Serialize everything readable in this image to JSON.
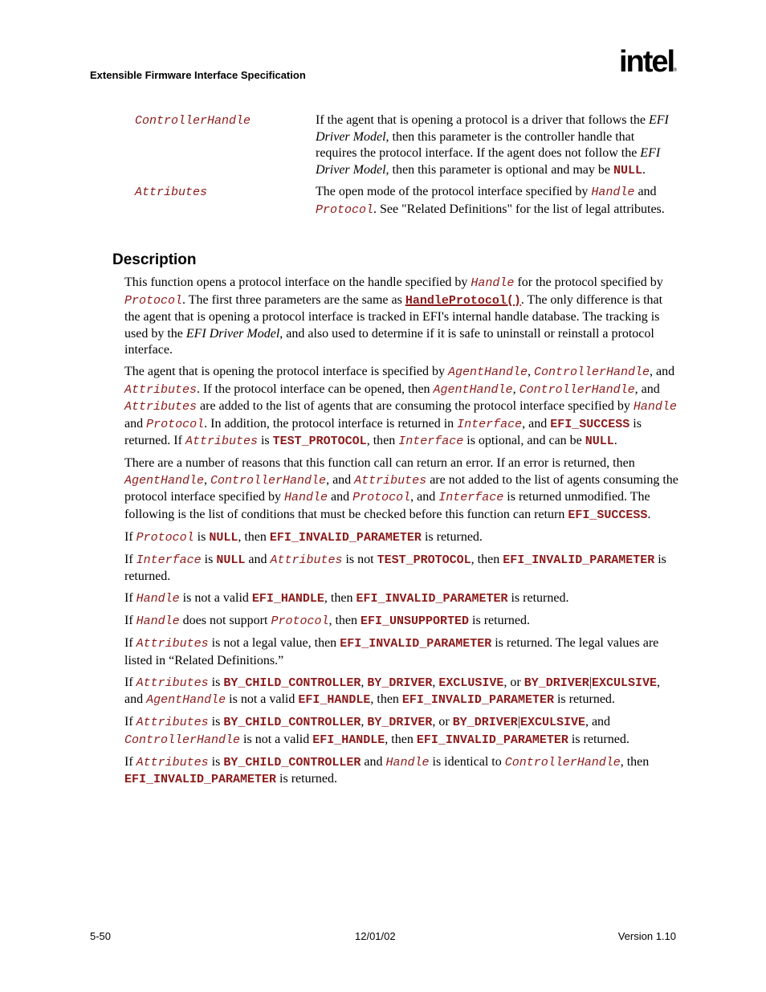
{
  "header": {
    "title": "Extensible Firmware Interface Specification",
    "logo_text": "intel",
    "logo_mark": "®"
  },
  "parameters": [
    {
      "name": "ControllerHandle",
      "desc": [
        {
          "t": "text",
          "v": "If the agent that is opening a protocol is a driver that follows the "
        },
        {
          "t": "em",
          "v": "EFI Driver Model"
        },
        {
          "t": "text",
          "v": ", then this parameter is the controller handle that requires the protocol interface.  If the agent does not follow the "
        },
        {
          "t": "em",
          "v": "EFI Driver Model"
        },
        {
          "t": "text",
          "v": ", then this parameter is optional and may be "
        },
        {
          "t": "kw",
          "v": "NULL"
        },
        {
          "t": "text",
          "v": "."
        }
      ]
    },
    {
      "name": "Attributes",
      "desc": [
        {
          "t": "text",
          "v": "The open mode of the protocol interface specified by "
        },
        {
          "t": "arg",
          "v": "Handle"
        },
        {
          "t": "text",
          "v": " and "
        },
        {
          "t": "arg",
          "v": "Protocol"
        },
        {
          "t": "text",
          "v": ".  See \"Related Definitions\" for the list of legal attributes."
        }
      ]
    }
  ],
  "section_heading": "Description",
  "paragraphs": [
    [
      {
        "t": "text",
        "v": "This function opens a protocol interface on the handle specified by "
      },
      {
        "t": "arg",
        "v": "Handle"
      },
      {
        "t": "text",
        "v": " for the protocol specified by "
      },
      {
        "t": "arg",
        "v": "Protocol"
      },
      {
        "t": "text",
        "v": ".  The first three parameters are the same as "
      },
      {
        "t": "link",
        "v": "HandleProtocol()"
      },
      {
        "t": "text",
        "v": ".  The only difference is that the agent that is opening a protocol interface is tracked in EFI's internal handle database.  The tracking is used by the "
      },
      {
        "t": "em",
        "v": "EFI Driver Model"
      },
      {
        "t": "text",
        "v": ", and also used to determine if it is safe to uninstall or reinstall a protocol interface."
      }
    ],
    [
      {
        "t": "text",
        "v": "The agent that is opening the protocol interface is specified by "
      },
      {
        "t": "arg",
        "v": "AgentHandle"
      },
      {
        "t": "text",
        "v": ", "
      },
      {
        "t": "arg",
        "v": "ControllerHandle"
      },
      {
        "t": "text",
        "v": ", and "
      },
      {
        "t": "arg",
        "v": "Attributes"
      },
      {
        "t": "text",
        "v": ".  If the protocol interface can be opened, then "
      },
      {
        "t": "arg",
        "v": "AgentHandle"
      },
      {
        "t": "text",
        "v": ", "
      },
      {
        "t": "arg",
        "v": "ControllerHandle"
      },
      {
        "t": "text",
        "v": ", and "
      },
      {
        "t": "arg",
        "v": "Attributes"
      },
      {
        "t": "text",
        "v": " are added to the list of agents that are consuming the protocol interface specified by "
      },
      {
        "t": "arg",
        "v": "Handle"
      },
      {
        "t": "text",
        "v": " and "
      },
      {
        "t": "arg",
        "v": "Protocol"
      },
      {
        "t": "text",
        "v": ".  In addition, the protocol interface is returned in "
      },
      {
        "t": "arg",
        "v": "Interface"
      },
      {
        "t": "text",
        "v": ", and "
      },
      {
        "t": "kw",
        "v": "EFI_SUCCESS"
      },
      {
        "t": "text",
        "v": " is returned.  If "
      },
      {
        "t": "arg",
        "v": "Attributes"
      },
      {
        "t": "text",
        "v": " is "
      },
      {
        "t": "kw",
        "v": "TEST_PROTOCOL"
      },
      {
        "t": "text",
        "v": ", then "
      },
      {
        "t": "arg",
        "v": "Interface"
      },
      {
        "t": "text",
        "v": " is optional, and can be "
      },
      {
        "t": "kw",
        "v": "NULL"
      },
      {
        "t": "text",
        "v": "."
      }
    ],
    [
      {
        "t": "text",
        "v": "There are a number of reasons that this function call can return an error.  If an error is returned, then "
      },
      {
        "t": "arg",
        "v": "AgentHandle"
      },
      {
        "t": "text",
        "v": ", "
      },
      {
        "t": "arg",
        "v": "ControllerHandle"
      },
      {
        "t": "text",
        "v": ", and "
      },
      {
        "t": "arg",
        "v": "Attributes"
      },
      {
        "t": "text",
        "v": " are not added to the list of agents consuming the protocol interface specified by "
      },
      {
        "t": "arg",
        "v": "Handle"
      },
      {
        "t": "text",
        "v": " and "
      },
      {
        "t": "arg",
        "v": "Protocol"
      },
      {
        "t": "text",
        "v": ", and "
      },
      {
        "t": "arg",
        "v": "Interface"
      },
      {
        "t": "text",
        "v": " is returned unmodified.  The following is the list of conditions that must be checked before this function can return "
      },
      {
        "t": "kw",
        "v": "EFI_SUCCESS"
      },
      {
        "t": "text",
        "v": "."
      }
    ],
    [
      {
        "t": "text",
        "v": "If "
      },
      {
        "t": "arg",
        "v": "Protocol"
      },
      {
        "t": "text",
        "v": " is "
      },
      {
        "t": "kw",
        "v": "NULL"
      },
      {
        "t": "text",
        "v": ", then "
      },
      {
        "t": "kw",
        "v": "EFI_INVALID_PARAMETER"
      },
      {
        "t": "text",
        "v": " is returned."
      }
    ],
    [
      {
        "t": "text",
        "v": "If "
      },
      {
        "t": "arg",
        "v": "Interface"
      },
      {
        "t": "text",
        "v": " is "
      },
      {
        "t": "kw",
        "v": "NULL"
      },
      {
        "t": "text",
        "v": " and "
      },
      {
        "t": "arg",
        "v": "Attributes"
      },
      {
        "t": "text",
        "v": " is not "
      },
      {
        "t": "kw",
        "v": "TEST_PROTOCOL"
      },
      {
        "t": "text",
        "v": ", then "
      },
      {
        "t": "kw",
        "v": "EFI_INVALID_PARAMETER"
      },
      {
        "t": "text",
        "v": " is returned."
      }
    ],
    [
      {
        "t": "text",
        "v": "If "
      },
      {
        "t": "arg",
        "v": "Handle"
      },
      {
        "t": "text",
        "v": " is not a valid "
      },
      {
        "t": "kw",
        "v": "EFI_HANDLE"
      },
      {
        "t": "text",
        "v": ", then "
      },
      {
        "t": "kw",
        "v": "EFI_INVALID_PARAMETER"
      },
      {
        "t": "text",
        "v": " is returned."
      }
    ],
    [
      {
        "t": "text",
        "v": "If "
      },
      {
        "t": "arg",
        "v": "Handle"
      },
      {
        "t": "text",
        "v": " does not support "
      },
      {
        "t": "arg",
        "v": "Protocol"
      },
      {
        "t": "text",
        "v": ", then "
      },
      {
        "t": "kw",
        "v": "EFI_UNSUPPORTED"
      },
      {
        "t": "text",
        "v": " is returned."
      }
    ],
    [
      {
        "t": "text",
        "v": "If "
      },
      {
        "t": "arg",
        "v": "Attributes"
      },
      {
        "t": "text",
        "v": " is not a legal value, then "
      },
      {
        "t": "kw",
        "v": "EFI_INVALID_PARAMETER"
      },
      {
        "t": "text",
        "v": " is returned.  The legal values are listed in “Related Definitions.”"
      }
    ],
    [
      {
        "t": "text",
        "v": "If "
      },
      {
        "t": "arg",
        "v": "Attributes"
      },
      {
        "t": "text",
        "v": " is "
      },
      {
        "t": "kw",
        "v": "BY_CHILD_CONTROLLER"
      },
      {
        "t": "text",
        "v": ", "
      },
      {
        "t": "kw",
        "v": "BY_DRIVER"
      },
      {
        "t": "text",
        "v": ", "
      },
      {
        "t": "kw",
        "v": "EXCLUSIVE"
      },
      {
        "t": "text",
        "v": ", or "
      },
      {
        "t": "kw",
        "v": "BY_DRIVER"
      },
      {
        "t": "bar",
        "v": "|"
      },
      {
        "t": "kw",
        "v": "EXCULSIVE"
      },
      {
        "t": "text",
        "v": ", and "
      },
      {
        "t": "arg",
        "v": "AgentHandle"
      },
      {
        "t": "text",
        "v": " is not a valid "
      },
      {
        "t": "kw",
        "v": "EFI_HANDLE"
      },
      {
        "t": "text",
        "v": ", then "
      },
      {
        "t": "kw",
        "v": "EFI_INVALID_PARAMETER"
      },
      {
        "t": "text",
        "v": " is returned."
      }
    ],
    [
      {
        "t": "text",
        "v": "If "
      },
      {
        "t": "arg",
        "v": "Attributes"
      },
      {
        "t": "text",
        "v": " is "
      },
      {
        "t": "kw",
        "v": "BY_CHILD_CONTROLLER"
      },
      {
        "t": "text",
        "v": ", "
      },
      {
        "t": "kw",
        "v": "BY_DRIVER"
      },
      {
        "t": "text",
        "v": ", or "
      },
      {
        "t": "kw",
        "v": "BY_DRIVER"
      },
      {
        "t": "bar",
        "v": "|"
      },
      {
        "t": "kw",
        "v": "EXCULSIVE"
      },
      {
        "t": "text",
        "v": ", and "
      },
      {
        "t": "arg",
        "v": "ControllerHandle"
      },
      {
        "t": "text",
        "v": " is not a valid "
      },
      {
        "t": "kw",
        "v": "EFI_HANDLE"
      },
      {
        "t": "text",
        "v": ", then "
      },
      {
        "t": "kw",
        "v": "EFI_INVALID_PARAMETER"
      },
      {
        "t": "text",
        "v": " is returned."
      }
    ],
    [
      {
        "t": "text",
        "v": "If "
      },
      {
        "t": "arg",
        "v": "Attributes"
      },
      {
        "t": "text",
        "v": " is "
      },
      {
        "t": "kw",
        "v": "BY_CHILD_CONTROLLER"
      },
      {
        "t": "text",
        "v": " and "
      },
      {
        "t": "arg",
        "v": "Handle"
      },
      {
        "t": "text",
        "v": " is identical to "
      },
      {
        "t": "arg",
        "v": "ControllerHandle"
      },
      {
        "t": "text",
        "v": ", then "
      },
      {
        "t": "kw",
        "v": "EFI_INVALID_PARAMETER"
      },
      {
        "t": "text",
        "v": " is returned."
      }
    ]
  ],
  "footer": {
    "page_number": "5-50",
    "date": "12/01/02",
    "version": "Version 1.10"
  },
  "colors": {
    "code_text": "#8b1a1a",
    "body_text": "#000000"
  }
}
